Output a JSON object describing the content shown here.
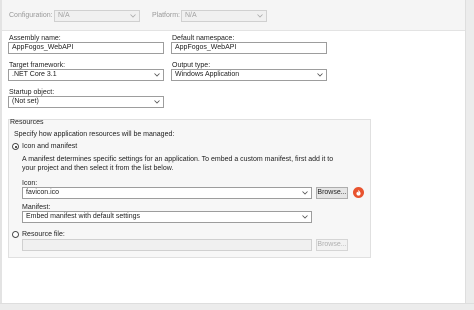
{
  "toolbar": {
    "configuration_label": "Configuration:",
    "configuration_value": "N/A",
    "platform_label": "Platform:",
    "platform_value": "N/A"
  },
  "application": {
    "assembly_name_label": "Assembly name:",
    "assembly_name_value": "AppFogos_WebAPI",
    "default_namespace_label": "Default namespace:",
    "default_namespace_value": "AppFogos_WebAPI",
    "target_framework_label": "Target framework:",
    "target_framework_value": ".NET Core 3.1",
    "output_type_label": "Output type:",
    "output_type_value": "Windows Application",
    "startup_object_label": "Startup object:",
    "startup_object_value": "(Not set)"
  },
  "resources": {
    "group_label": "Resources",
    "description": "Specify how application resources will be managed:",
    "icon_manifest_option": "Icon and manifest",
    "icon_manifest_selected": true,
    "help_text_line1": "A manifest determines specific settings for an application. To embed a custom manifest, first add it to",
    "help_text_line2": "your project and then select it from the list below.",
    "icon_label": "Icon:",
    "icon_value": "favicon.ico",
    "browse_label": "Browse...",
    "manifest_label": "Manifest:",
    "manifest_value": "Embed manifest with default settings",
    "resource_file_option": "Resource file:",
    "resource_file_selected": false,
    "resource_file_value": "",
    "resource_browse_label": "Browse..."
  },
  "colors": {
    "badge": "#e8532f",
    "background": "#ffffff",
    "group_background": "#f7f7f7"
  },
  "icons": [
    "chevron-down-icon",
    "fire-icon",
    "radio-button-icon"
  ]
}
